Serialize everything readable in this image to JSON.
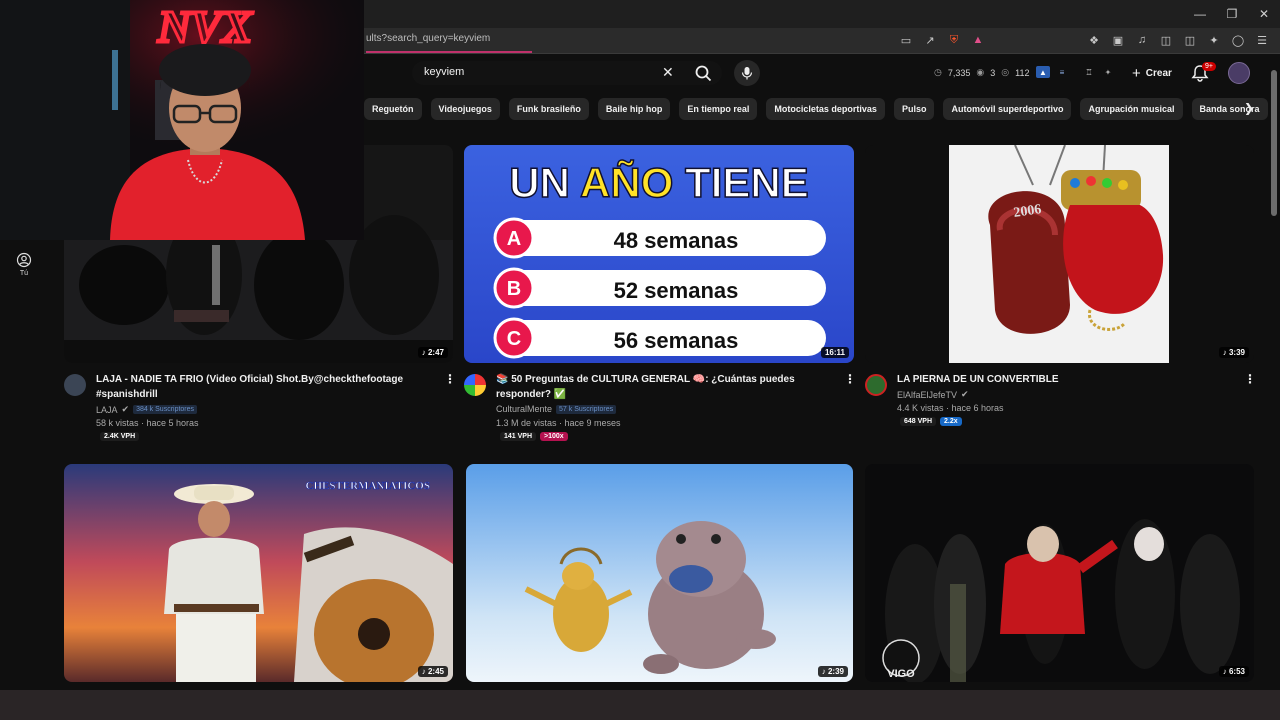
{
  "browser": {
    "url": "ults?search_query=keyviem",
    "window_controls": [
      "minimize",
      "restore",
      "close"
    ]
  },
  "youtube": {
    "search": {
      "value": "keyviem"
    },
    "stats": {
      "a": "7,335",
      "b": "3",
      "c": "112"
    },
    "create_label": "Crear",
    "notif_badge": "9+",
    "sidebar_you": "Tú",
    "chips": [
      "Reguetón",
      "Videojuegos",
      "Funk brasileño",
      "Baile hip hop",
      "En tiempo real",
      "Motocicletas deportivas",
      "Pulso",
      "Automóvil superdeportivo",
      "Agrupación musical",
      "Banda sonora"
    ]
  },
  "webcam": {
    "neon_text": "NVX"
  },
  "videos": [
    {
      "title": "LAJA - NADIE TA FRIO (Video Oficial) Shot.By@checkthefootage #spanishdrill",
      "channel": "LAJA",
      "subs": "384 k Suscriptores",
      "views": "58 k vistas · hace 5 horas",
      "vph": "2.4K VPH",
      "duration": "2:47"
    },
    {
      "title": "📚 50 Preguntas de CULTURA GENERAL 🧠: ¿Cuántas puedes responder? ✅",
      "channel": "CulturalMente",
      "subs": "57 k Suscriptores",
      "views": "1.3 M de vistas · hace 9 meses",
      "vph": "141 VPH",
      "multiplier": ">100x",
      "duration": "16:11",
      "thumb_heading_1": "UN ",
      "thumb_heading_2": "AÑO",
      "thumb_heading_3": " TIENE",
      "options": [
        {
          "letter": "A",
          "text": "48 semanas"
        },
        {
          "letter": "B",
          "text": "52 semanas"
        },
        {
          "letter": "C",
          "text": "56 semanas"
        }
      ]
    },
    {
      "title": "LA PIERNA DE UN CONVERTIBLE",
      "channel": "ElAlfaElJefeTV",
      "views": "4.4 K vistas · hace 6 horas",
      "vph": "648 VPH",
      "multiplier": "2.2x",
      "duration": "3:39",
      "glove_text": "2006"
    },
    {
      "duration": "2:45",
      "watermark": "CHESTERMANIATICOS"
    },
    {
      "duration": "2:39"
    },
    {
      "duration": "6:53",
      "logo_text": "VIGO"
    }
  ]
}
